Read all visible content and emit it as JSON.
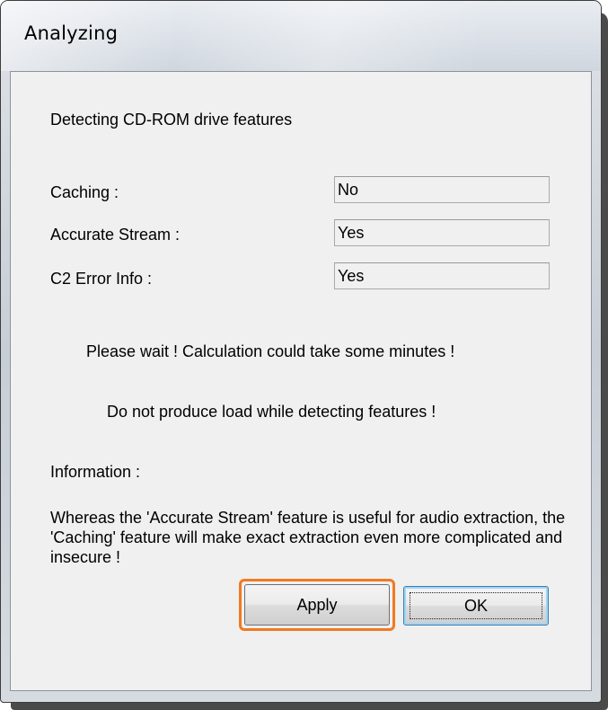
{
  "window": {
    "title": "Analyzing"
  },
  "dialog": {
    "heading": "Detecting CD-ROM drive features",
    "features": [
      {
        "label": "Caching :",
        "value": "No"
      },
      {
        "label": "Accurate Stream :",
        "value": "Yes"
      },
      {
        "label": "C2 Error Info :",
        "value": "Yes"
      }
    ],
    "wait_message": "Please wait !  Calculation could take some minutes !",
    "load_warning": "Do not produce load while detecting features !",
    "information_label": "Information :",
    "information_text": "Whereas the 'Accurate Stream' feature is useful for audio extraction, the 'Caching' feature will make exact extraction even more complicated and insecure !"
  },
  "buttons": {
    "apply_label": "Apply",
    "ok_label": "OK"
  },
  "colors": {
    "highlight": "#f07a22",
    "default_button_border": "#3c7fb1"
  }
}
